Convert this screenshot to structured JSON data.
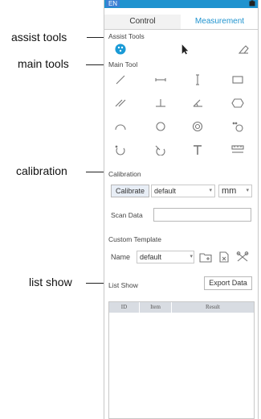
{
  "callouts": {
    "assist_tools": "assist tools",
    "main_tools": "main tools",
    "calibration": "calibration",
    "list_show": "list show"
  },
  "topbar": {
    "lang": "EN",
    "color": "#1f93cf"
  },
  "tabs": [
    {
      "label": "Control",
      "active": false
    },
    {
      "label": "Measurement",
      "active": true
    }
  ],
  "assist_tools": {
    "title": "Assist Tools",
    "tools": [
      "palette-icon",
      "pointer-arrow-icon",
      "eraser-icon"
    ]
  },
  "main_tool": {
    "title": "Main Tool",
    "tools": [
      "line-icon",
      "horizontal-line-icon",
      "vertical-line-icon",
      "rectangle-icon",
      "parallel-lines-icon",
      "perpendicular-icon",
      "angle-icon",
      "polygon-icon",
      "arc-icon",
      "circle-icon",
      "concentric-circle-icon",
      "point-circle-icon",
      "arc-point-icon",
      "arc-angle-icon",
      "text-icon",
      "scale-bar-icon"
    ]
  },
  "calibration": {
    "title": "Calibration",
    "button": "Calibrate",
    "profile": "default",
    "unit": "mm"
  },
  "scan_data": {
    "label": "Scan Data",
    "value": ""
  },
  "custom_template": {
    "title": "Custom Template",
    "name_label": "Name",
    "value": "default"
  },
  "list_show": {
    "title": "List Show",
    "export_button": "Export Data",
    "columns": [
      "ID",
      "Item",
      "Result"
    ],
    "rows": []
  }
}
